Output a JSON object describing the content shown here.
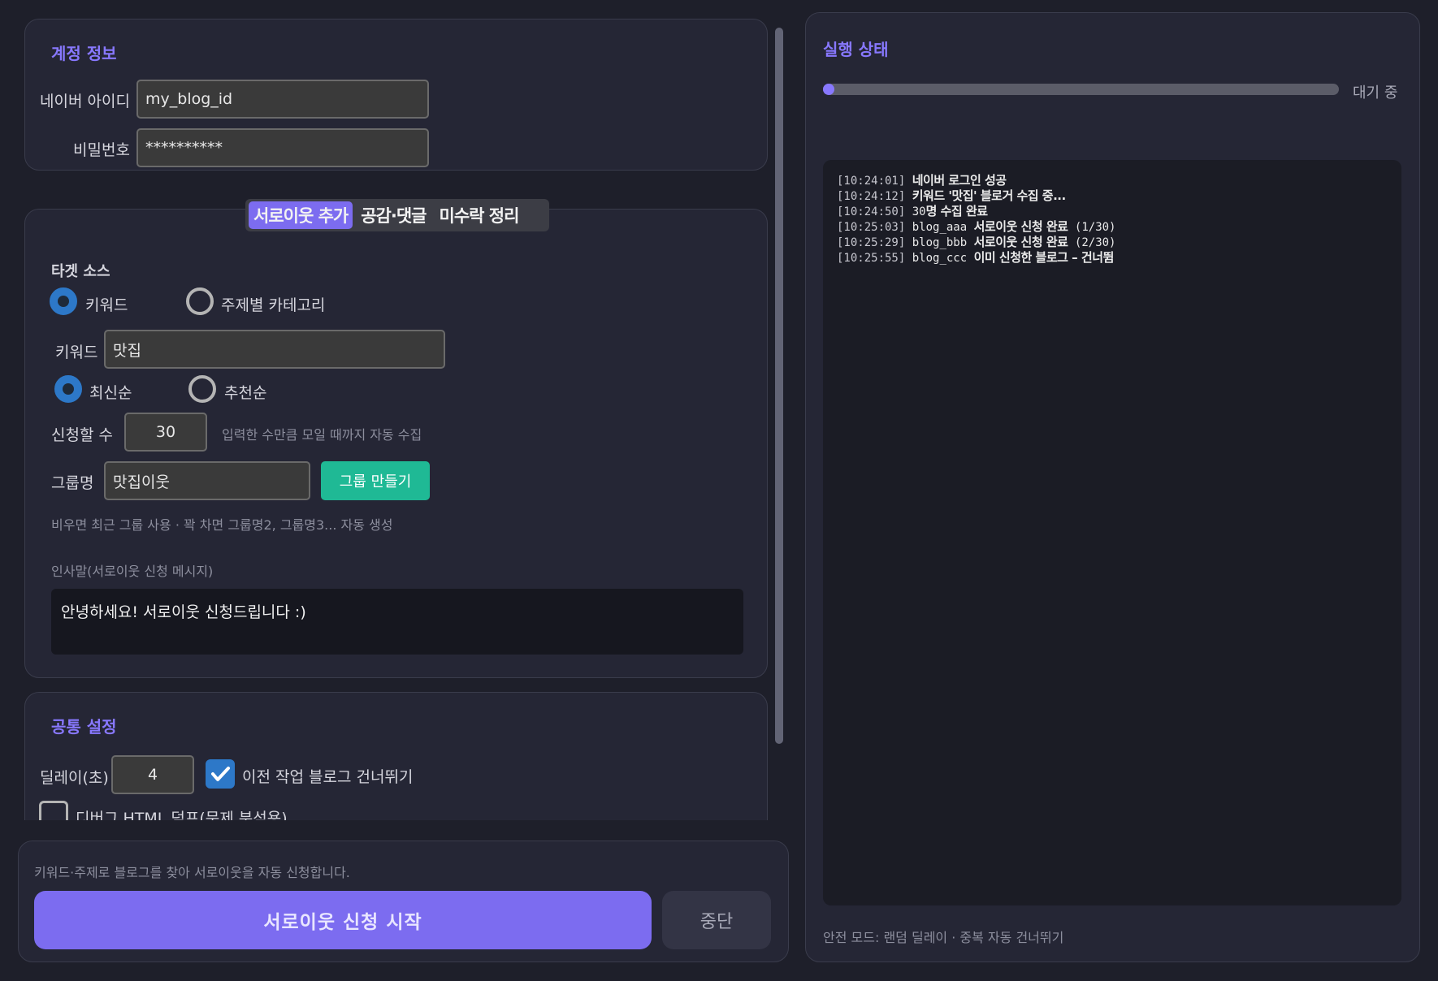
{
  "account": {
    "title": "계정 정보",
    "id_label": "네이버 아이디",
    "id_value": "my_blog_id",
    "pw_label": "비밀번호",
    "pw_value": "**********"
  },
  "tabs": [
    {
      "label": "서로이웃 추가",
      "active": true
    },
    {
      "label": "공감·댓글",
      "active": false
    },
    {
      "label": "미수락 정리",
      "active": false
    }
  ],
  "target": {
    "title": "타겟 소스",
    "source_options": [
      {
        "label": "키워드",
        "selected": true
      },
      {
        "label": "주제별 카테고리",
        "selected": false
      }
    ],
    "keyword_label": "키워드",
    "keyword_value": "맛집",
    "sort_options": [
      {
        "label": "최신순",
        "selected": true
      },
      {
        "label": "추천순",
        "selected": false
      }
    ],
    "count_label": "신청할 수",
    "count_value": "30",
    "count_hint": "입력한 수만큼 모일 때까지 자동 수집",
    "group_label": "그룹명",
    "group_value": "맛집이웃",
    "group_button": "그룹 만들기",
    "group_hint": "비우면 최근 그룹 사용 · 꽉 차면 그룹명2, 그룹명3... 자동 생성",
    "greeting_label": "인사말(서로이웃 신청 메시지)",
    "greeting_value": "안녕하세요! 서로이웃 신청드립니다 :)"
  },
  "common": {
    "title": "공통 설정",
    "delay_label": "딜레이(초)",
    "delay_value": "4",
    "skip_label": "이전 작업 블로그 건너뛰기",
    "skip_checked": true,
    "debug_label": "디버그 HTML 덤프(문제 분석용)",
    "debug_checked": false
  },
  "action": {
    "description": "키워드·주제로 블로그를 찾아 서로이웃을 자동 신청합니다.",
    "start_label": "서로이웃 신청 시작",
    "stop_label": "중단"
  },
  "status": {
    "title": "실행 상태",
    "state_text": "대기 중",
    "progress": 0,
    "logs": [
      {
        "ts": "[10:24:01]",
        "pre": "",
        "msg": "네이버 로그인 성공",
        "post": ""
      },
      {
        "ts": "[10:24:12]",
        "pre": "",
        "msg": "키워드 '맛집' 블로거 수집 중...",
        "post": ""
      },
      {
        "ts": "[10:24:50]",
        "pre": "30",
        "msg": "명 수집 완료",
        "post": ""
      },
      {
        "ts": "[10:25:03]",
        "pre": "blog_aaa",
        "msg": "서로이웃 신청 완료",
        "post": "(1/30)"
      },
      {
        "ts": "[10:25:29]",
        "pre": "blog_bbb",
        "msg": "서로이웃 신청 완료",
        "post": "(2/30)"
      },
      {
        "ts": "[10:25:55]",
        "pre": "blog_ccc",
        "msg": "이미 신청한 블로그 – 건너뜀",
        "post": ""
      }
    ],
    "footer": "안전 모드: 랜덤 딜레이 · 중복 자동 건너뛰기"
  }
}
